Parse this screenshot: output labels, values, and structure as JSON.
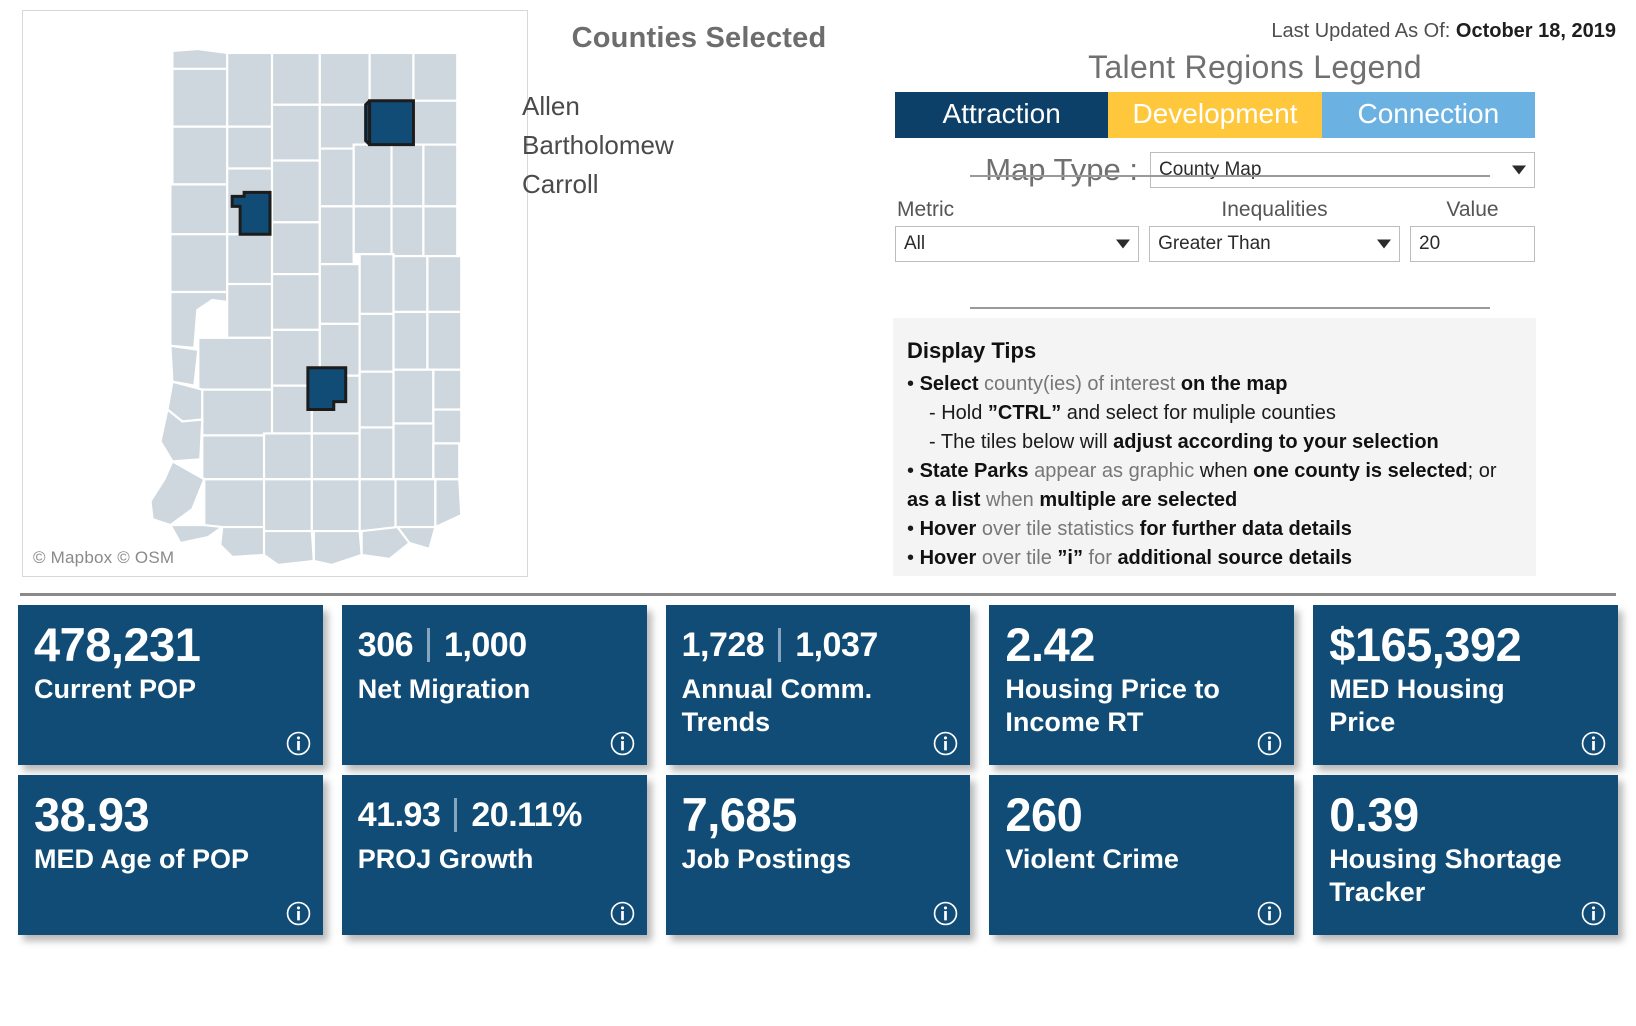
{
  "map": {
    "attribution": "© Mapbox  © OSM",
    "selected_counties_on_map": [
      "Allen",
      "Carroll",
      "Bartholomew"
    ]
  },
  "counties_panel": {
    "title": "Counties Selected",
    "counties": [
      "Allen",
      "Bartholomew",
      "Carroll"
    ]
  },
  "header": {
    "last_updated_label": "Last Updated As Of:",
    "last_updated_value": "October 18, 2019"
  },
  "legend": {
    "title": "Talent Regions Legend",
    "segments": [
      {
        "label": "Attraction",
        "color": "#0d4068"
      },
      {
        "label": "Development",
        "color": "#ffc83c"
      },
      {
        "label": "Connection",
        "color": "#6bb2e3"
      }
    ]
  },
  "map_type": {
    "label": "Map Type :",
    "value": "County Map"
  },
  "filters": {
    "metric": {
      "label": "Metric",
      "value": "All"
    },
    "inequalities": {
      "label": "Inequalities",
      "value": "Greater Than"
    },
    "value": {
      "label": "Value",
      "value": "20"
    }
  },
  "tips": {
    "title": "Display Tips",
    "lines": [
      {
        "parts": [
          {
            "t": "• ",
            "s": "plain"
          },
          {
            "t": "Select",
            "s": "bold"
          },
          {
            "t": " county(ies) of interest ",
            "s": "grey"
          },
          {
            "t": "on the map",
            "s": "bold"
          }
        ],
        "indent": false
      },
      {
        "parts": [
          {
            "t": "- Hold ",
            "s": "plain"
          },
          {
            "t": "”CTRL”",
            "s": "bold"
          },
          {
            "t": " and select for muliple counties",
            "s": "plain"
          }
        ],
        "indent": true
      },
      {
        "parts": [
          {
            "t": "- The tiles below will ",
            "s": "plain"
          },
          {
            "t": "adjust according to your selection",
            "s": "bold"
          }
        ],
        "indent": true
      },
      {
        "parts": [
          {
            "t": "• ",
            "s": "plain"
          },
          {
            "t": "State Parks",
            "s": "bold"
          },
          {
            "t": " appear as graphic ",
            "s": "grey"
          },
          {
            "t": "when ",
            "s": "plain"
          },
          {
            "t": "one county is selected",
            "s": "bold"
          },
          {
            "t": "; or",
            "s": "plain"
          }
        ],
        "indent": false
      },
      {
        "parts": [
          {
            "t": "as a list",
            "s": "bold"
          },
          {
            "t": " when ",
            "s": "grey"
          },
          {
            "t": "multiple are selected",
            "s": "bold"
          }
        ],
        "indent": false
      },
      {
        "parts": [
          {
            "t": "• ",
            "s": "plain"
          },
          {
            "t": "Hover",
            "s": "bold"
          },
          {
            "t": " over tile statistics ",
            "s": "grey"
          },
          {
            "t": "for further data details",
            "s": "bold"
          }
        ],
        "indent": false
      },
      {
        "parts": [
          {
            "t": "• ",
            "s": "plain"
          },
          {
            "t": "Hover",
            "s": "bold"
          },
          {
            "t": " over tile ",
            "s": "grey"
          },
          {
            "t": "”i”",
            "s": "bold"
          },
          {
            "t": " for ",
            "s": "grey"
          },
          {
            "t": "additional source details",
            "s": "bold"
          }
        ],
        "indent": false
      }
    ]
  },
  "tiles": {
    "color": "#104c76",
    "rows": [
      [
        {
          "value": "478,231",
          "value2": null,
          "label": "Current POP",
          "info": "info-icon"
        },
        {
          "value": "306",
          "value2": "1,000",
          "label": "Net Migration",
          "info": "info-icon"
        },
        {
          "value": "1,728",
          "value2": "1,037",
          "label": "Annual Comm. Trends",
          "info": "info-icon"
        },
        {
          "value": "2.42",
          "value2": null,
          "label": "Housing Price to Income RT",
          "info": "info-icon"
        },
        {
          "value": "$165,392",
          "value2": null,
          "label": "MED Housing Price",
          "info": "info-icon"
        }
      ],
      [
        {
          "value": "38.93",
          "value2": null,
          "label": "MED Age of POP",
          "info": "info-icon"
        },
        {
          "value": "41.93",
          "value2": "20.11%",
          "label": "PROJ Growth",
          "info": "info-icon"
        },
        {
          "value": "7,685",
          "value2": null,
          "label": "Job Postings",
          "info": "info-icon"
        },
        {
          "value": "260",
          "value2": null,
          "label": "Violent Crime",
          "info": "info-icon"
        },
        {
          "value": "0.39",
          "value2": null,
          "label": "Housing Shortage Tracker",
          "info": "info-icon"
        }
      ]
    ]
  }
}
